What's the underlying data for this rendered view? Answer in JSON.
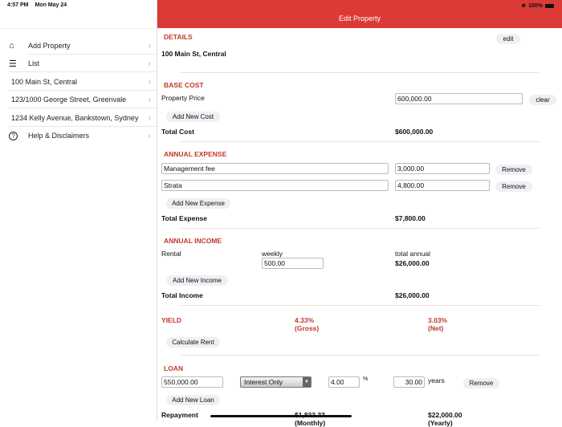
{
  "status": {
    "time": "4:57 PM",
    "date": "Mon May 24",
    "battery": "100%"
  },
  "header": {
    "title": "Edit Property"
  },
  "sidebar": {
    "items": [
      {
        "label": "Add Property",
        "icon": "home-icon"
      },
      {
        "label": "List",
        "icon": "list-icon"
      },
      {
        "label": "100 Main St, Central"
      },
      {
        "label": "123/1000 George Street, Greenvale"
      },
      {
        "label": "1234 Kelly Avenue, Bankstown, Sydney"
      },
      {
        "label": "Help & Disclaimers",
        "icon": "help-icon"
      }
    ]
  },
  "details": {
    "title": "DETAILS",
    "edit": "edit",
    "address": "100 Main St, Central"
  },
  "base_cost": {
    "title": "BASE COST",
    "price_label": "Property Price",
    "price_value": "600,000.00",
    "clear": "clear",
    "add": "Add New Cost",
    "total_label": "Total Cost",
    "total": "$600,000.00"
  },
  "expense": {
    "title": "ANNUAL EXPENSE",
    "rows": [
      {
        "name": "Management fee",
        "amount": "3,000.00"
      },
      {
        "name": "Strata",
        "amount": "4,800.00"
      }
    ],
    "remove": "Remove",
    "add": "Add New Expense",
    "total_label": "Total Expense",
    "total": "$7,800.00"
  },
  "income": {
    "title": "ANNUAL INCOME",
    "rental": "Rental",
    "weekly": "weekly",
    "weekly_value": "500.00",
    "annual_label": "total annual",
    "annual_value": "$26,000.00",
    "add": "Add New Income",
    "total_label": "Total Income",
    "total": "$26,000.00"
  },
  "yield": {
    "title": "YIELD",
    "gross": "4.33%",
    "gross_label": "(Gross)",
    "net": "3.03%",
    "net_label": "(Net)",
    "calc": "Calculate Rent"
  },
  "loan": {
    "title": "LOAN",
    "amount": "550,000.00",
    "type": "Interest Only",
    "rate": "4.00",
    "pct": "%",
    "years": "30.00",
    "years_label": "years",
    "remove": "Remove",
    "add": "Add New Loan",
    "repayment": "Repayment",
    "monthly": "$1,833.33",
    "monthly_label": "(Monthly)",
    "yearly": "$22,000.00",
    "yearly_label": "(Yearly)"
  }
}
